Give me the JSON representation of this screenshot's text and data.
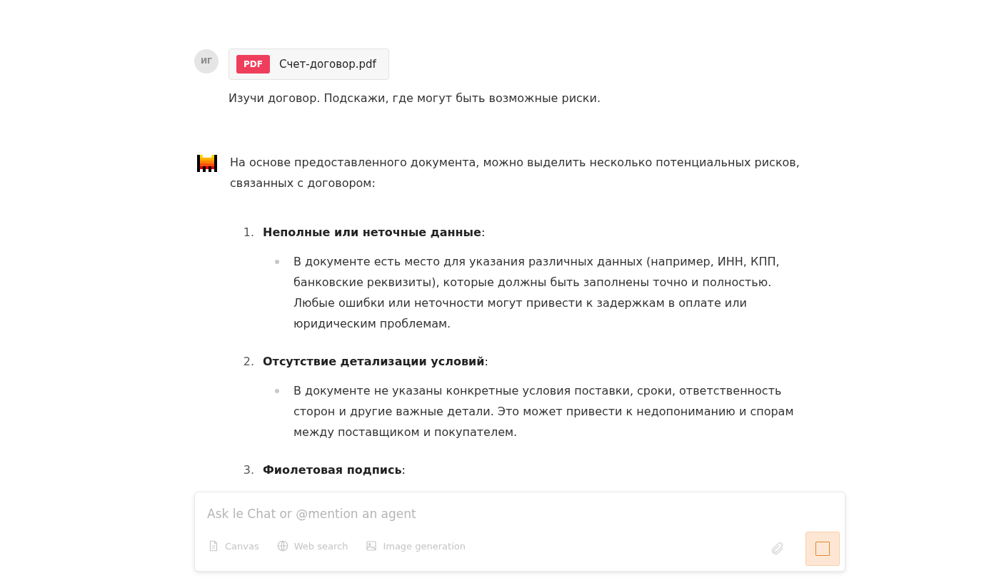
{
  "user_message": {
    "avatar": "ИГ",
    "attachment": {
      "badge": "PDF",
      "name": "Счет-договор.pdf"
    },
    "text": "Изучи договор. Подскажи, где могут быть возможные риски."
  },
  "assistant_message": {
    "intro": "На основе предоставленного документа, можно выделить несколько потенциальных рисков, связанных с договором:",
    "items": [
      {
        "number": "1.",
        "title": "**Неполные или неточные данные**:",
        "bullets": [
          "В документе есть место для указания различных данных (например, ИНН, КПП, банковские реквизиты), которые должны быть заполнены точно и полностью. Любые ошибки или неточности могут привести к задержкам в оплате или юридическим проблемам."
        ]
      },
      {
        "number": "2.",
        "title": "**Отсутствие детализации условий**:",
        "bullets": [
          "В документе не указаны конкретные условия поставки, сроки, ответственность сторон и другие важные детали. Это может привести к недопониманию и спорам между поставщиком и покупателем."
        ]
      },
      {
        "number": "3.",
        "title": "**Фиолетовая подпись**:"
      }
    ]
  },
  "composer": {
    "placeholder": "Ask le Chat or @mention an agent",
    "tools": [
      {
        "kind": "canvas",
        "label": "Canvas",
        "disabled": true
      },
      {
        "kind": "web",
        "label": "Web search",
        "disabled": true
      },
      {
        "kind": "image",
        "label": "Image generation",
        "disabled": true
      }
    ],
    "generating": true
  }
}
